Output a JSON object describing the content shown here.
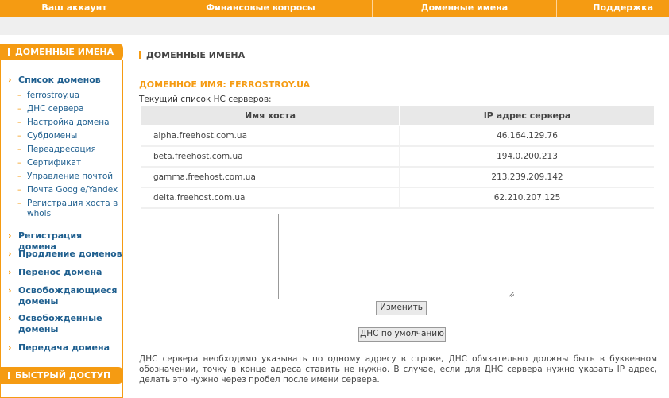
{
  "topnav": {
    "items": [
      "Ваш аккаунт",
      "Финансовые вопросы",
      "Доменные имена",
      "Поддержка"
    ]
  },
  "sidebar": {
    "header": "ДОМЕННЫЕ ИМЕНА",
    "domain_list": "Список доменов",
    "subitems": [
      "ferrostroy.ua",
      "ДНС сервера",
      "Настройка домена",
      "Субдомены",
      "Переадресация",
      "Сертификат",
      "Управление почтой",
      "Почта Google/Yandex",
      "Регистрация хоста в whois"
    ],
    "main_items": [
      "Регистрация домена",
      "Продление доменов",
      "Перенос домена",
      "Освобождающиеся домены",
      "Освобожденные домены",
      "Передача домена"
    ],
    "quick_access_header": "БЫСТРЫЙ ДОСТУП"
  },
  "main": {
    "page_title": "ДОМЕННЫЕ ИМЕНА",
    "domain_title": "ДОМЕННОЕ ИМЯ: FERROSTROY.UA",
    "ns_label": "Текущий список НС серверов:",
    "table": {
      "headers": [
        "Имя хоста",
        "IP адрес сервера"
      ],
      "rows": [
        {
          "host": "alpha.freehost.com.ua",
          "ip": "46.164.129.76"
        },
        {
          "host": "beta.freehost.com.ua",
          "ip": "194.0.200.213"
        },
        {
          "host": "gamma.freehost.com.ua",
          "ip": "213.239.209.142"
        },
        {
          "host": "delta.freehost.com.ua",
          "ip": "62.210.207.125"
        }
      ]
    },
    "textarea_value": "",
    "change_button": "Изменить",
    "default_dns_button": "ДНС по умолчанию",
    "note": "ДНС сервера необходимо указывать по одному адресу в строке, ДНС обязательно должны быть в буквенном обозначении, точку в конце адреса ставить не нужно. В случае, если для ДНС сервера нужно указать IP адрес, делать это нужно через пробел после имени сервера."
  },
  "colors": {
    "accent": "#f59b12",
    "link": "#1f5f8f"
  }
}
